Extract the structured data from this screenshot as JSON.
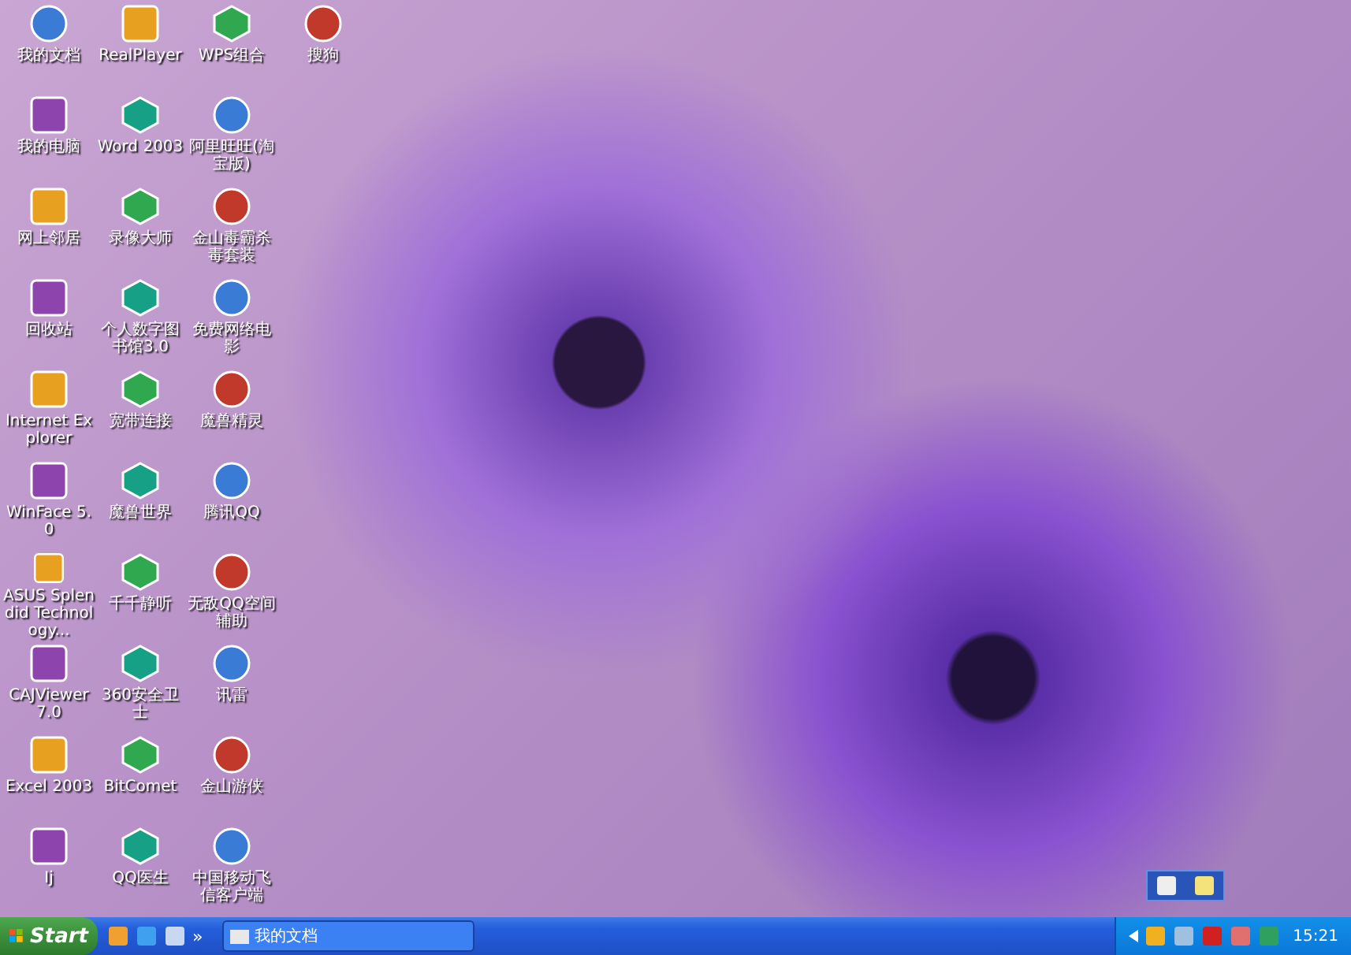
{
  "desktop": {
    "rows": [
      {
        "icons": [
          {
            "label": "我的文档"
          },
          {
            "label": "RealPlayer"
          },
          {
            "label": "WPS组合"
          },
          {
            "label": "搜狗"
          }
        ]
      },
      {
        "icons": [
          {
            "label": "我的电脑"
          },
          {
            "label": "Word 2003"
          },
          {
            "label": "阿里旺旺(淘宝版)"
          }
        ]
      },
      {
        "icons": [
          {
            "label": "网上邻居"
          },
          {
            "label": "录像大师"
          },
          {
            "label": "金山毒霸杀毒套装"
          }
        ]
      },
      {
        "icons": [
          {
            "label": "回收站"
          },
          {
            "label": "个人数字图书馆3.0"
          },
          {
            "label": "免费网络电影"
          }
        ]
      },
      {
        "icons": [
          {
            "label": "Internet Explorer"
          },
          {
            "label": "宽带连接"
          },
          {
            "label": "魔兽精灵"
          }
        ]
      },
      {
        "icons": [
          {
            "label": "WinFace 5.0"
          },
          {
            "label": "魔兽世界"
          },
          {
            "label": "腾讯QQ"
          }
        ]
      },
      {
        "icons": [
          {
            "label": "ASUS Splendid Technology..."
          },
          {
            "label": "千千静听"
          },
          {
            "label": "无敌QQ空间辅助"
          }
        ]
      },
      {
        "icons": [
          {
            "label": "CAJViewer 7.0"
          },
          {
            "label": "360安全卫士"
          },
          {
            "label": "讯雷"
          }
        ]
      },
      {
        "icons": [
          {
            "label": "Excel 2003"
          },
          {
            "label": "BitComet"
          },
          {
            "label": "金山游侠"
          }
        ]
      },
      {
        "icons": [
          {
            "label": "Ij"
          },
          {
            "label": "QQ医生"
          },
          {
            "label": "中国移动飞信客户端"
          }
        ]
      }
    ]
  },
  "taskbar": {
    "start": "Start",
    "more": "»",
    "tasks": [
      {
        "label": "我的文档",
        "selected": false
      }
    ],
    "clock": "15:21"
  }
}
